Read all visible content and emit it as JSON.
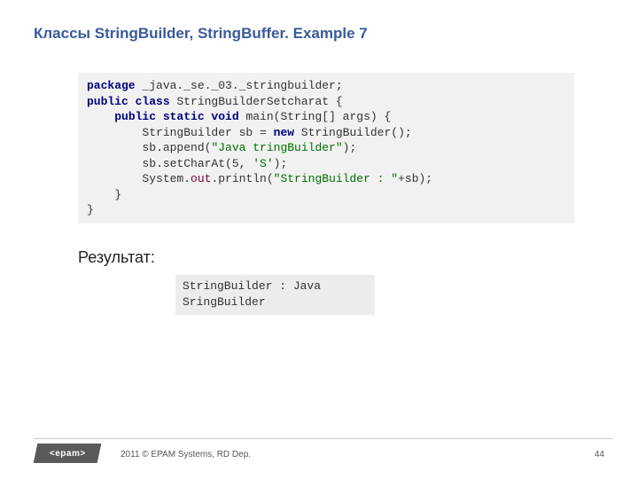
{
  "title": "Классы StringBuilder, StringBuffer. Example 7",
  "code": {
    "line1_kw": "package",
    "line1_rest": " _java._se._03._stringbuilder;",
    "line2_kw1": "public class",
    "line2_rest": " StringBuilderSetcharat {",
    "line3_kw": "public static void",
    "line3_rest": " main(String[] args) {",
    "line4_pre": "        StringBuilder sb = ",
    "line4_kw": "new",
    "line4_post": " StringBuilder();",
    "line5_pre": "        sb.append(",
    "line5_str": "\"Java tringBuilder\"",
    "line5_post": ");",
    "line6_pre": "        sb.setCharAt(5, ",
    "line6_str": "'S'",
    "line6_post": ");",
    "line7_pre": "        System.",
    "line7_fld": "out",
    "line7_mid": ".println(",
    "line7_str": "\"StringBuilder : \"",
    "line7_post": "+sb);",
    "line8": "    }",
    "line9": "}"
  },
  "result_label": "Результат:",
  "result": "StringBuilder : Java\nSringBuilder",
  "footer": {
    "logo": "<epam>",
    "copyright": "2011 © EPAM Systems, RD Dep.",
    "page": "44"
  }
}
